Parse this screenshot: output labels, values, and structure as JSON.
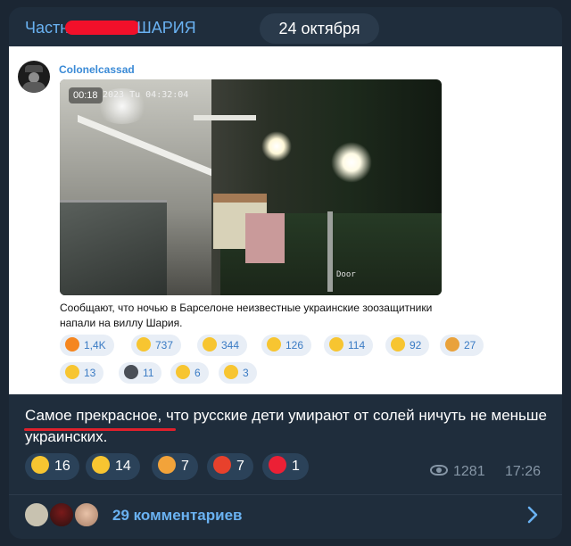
{
  "header": {
    "channel_prefix": "Частн",
    "channel_suffix": "ШАРИЯ",
    "date": "24 октября"
  },
  "forwarded": {
    "author": "Colonelcassad",
    "video": {
      "duration": "00:18",
      "timestamp_overlay": "2023 Tu 04:32:04",
      "camera_label": "Door"
    },
    "caption": "Сообщают, что ночью в Барселоне неизвестные украинские зоозащитники напали на виллу Шария.",
    "reactions": [
      {
        "emoji": "fire-emoji",
        "count": "1,4K",
        "color": "#f5861f"
      },
      {
        "emoji": "grinning-emoji",
        "count": "737",
        "color": "#f7c531"
      },
      {
        "emoji": "laughing-emoji",
        "count": "344",
        "color": "#f7c531"
      },
      {
        "emoji": "screaming-emoji",
        "count": "126",
        "color": "#f7c531"
      },
      {
        "emoji": "clapping-emoji",
        "count": "114",
        "color": "#f7c531"
      },
      {
        "emoji": "thumbs-up-emoji",
        "count": "92",
        "color": "#f7c531"
      },
      {
        "emoji": "party-popper-emoji",
        "count": "27",
        "color": "#e9a23b"
      },
      {
        "emoji": "lightning-emoji",
        "count": "13",
        "color": "#f7c531"
      },
      {
        "emoji": "dark-moon-emoji",
        "count": "11",
        "color": "#4a4f57"
      },
      {
        "emoji": "love-hearts-emoji",
        "count": "6",
        "color": "#f7c531"
      },
      {
        "emoji": "heart-eyes-emoji",
        "count": "3",
        "color": "#f7c531"
      }
    ]
  },
  "comment": {
    "highlighted": "Самое прекрасное",
    "rest": ", что русские дети умирают от солей ничуть не меньше украинских."
  },
  "reactions": [
    {
      "emoji": "grinning-emoji",
      "count": "16",
      "color": "#f7c531"
    },
    {
      "emoji": "thumbs-up-emoji",
      "count": "14",
      "color": "#f7c531"
    },
    {
      "emoji": "exploding-head-emoji",
      "count": "7",
      "color": "#f2a33a"
    },
    {
      "emoji": "angry-face-emoji",
      "count": "7",
      "color": "#e8412c"
    },
    {
      "emoji": "red-heart-emoji",
      "count": "1",
      "color": "#ec2035"
    }
  ],
  "meta": {
    "views": "1281",
    "time": "17:26"
  },
  "comments": {
    "label": "29 комментариев"
  }
}
